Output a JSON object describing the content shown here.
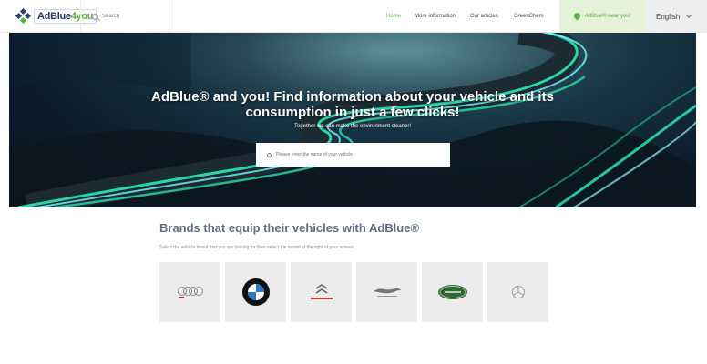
{
  "header": {
    "logo_text_a": "AdBlue",
    "logo_text_b": "4you",
    "search_placeholder": "Search",
    "nav": [
      {
        "label": "Home",
        "active": true
      },
      {
        "label": "More information",
        "active": false
      },
      {
        "label": "Our articles",
        "active": false
      },
      {
        "label": "GreenChem",
        "active": false
      }
    ],
    "near_button": "AdBlue® near you!",
    "language": "English"
  },
  "hero": {
    "title_line1": "AdBlue® and you! Find information about your vehicle and its",
    "title_line2": "consumption in just a few clicks!",
    "subtitle": "Together we can make the environment cleaner!",
    "search_placeholder": "Please enter the name of your vehicle"
  },
  "brands": {
    "title": "Brands that equip their vehicles with AdBlue®",
    "subtitle": "Select the vehicle brand that you are looking for then select the model at the right of your screen",
    "items": [
      {
        "name": "Audi",
        "icon": "audi-logo-icon"
      },
      {
        "name": "BMW",
        "icon": "bmw-logo-icon"
      },
      {
        "name": "CITROËN",
        "icon": "citroen-logo-icon"
      },
      {
        "name": "JAGUAR",
        "icon": "jaguar-logo-icon"
      },
      {
        "name": "LAND ROVER",
        "icon": "land-rover-logo-icon"
      },
      {
        "name": "Mercedes-Benz",
        "icon": "mercedes-logo-icon"
      }
    ]
  },
  "colors": {
    "accent_green": "#52b73b",
    "brand_navy": "#1f3566",
    "heading": "#5f6d84"
  }
}
